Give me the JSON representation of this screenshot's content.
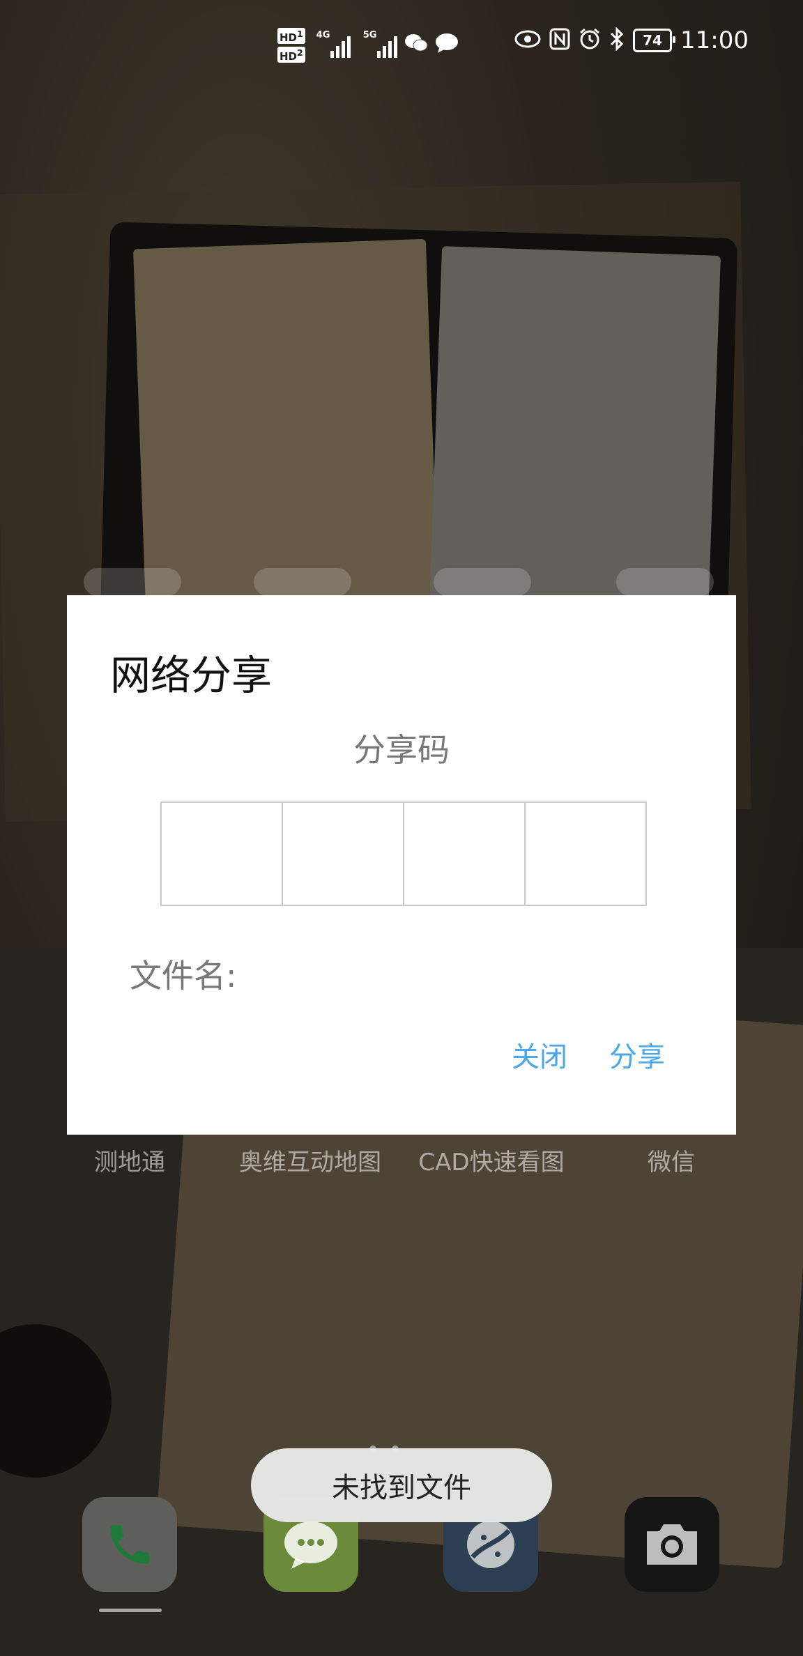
{
  "status_bar": {
    "hd1": "HD",
    "hd1_sub": "1",
    "hd2": "HD",
    "hd2_sub": "2",
    "net1": "4G",
    "net2": "5G",
    "battery": "74",
    "time": "11:00",
    "icons": [
      "hd-icon",
      "signal-icon",
      "wechat-icon",
      "message-icon",
      "eye-icon",
      "nfc-icon",
      "alarm-icon",
      "bluetooth-icon",
      "battery-icon"
    ]
  },
  "app_labels": [
    "测地通",
    "奥维互动地图",
    "CAD快速看图",
    "微信"
  ],
  "dialog": {
    "title": "网络分享",
    "subtitle": "分享码",
    "code_boxes": [
      "",
      "",
      "",
      ""
    ],
    "file_label": "文件名:",
    "close_label": "关闭",
    "share_label": "分享"
  },
  "toast": {
    "text": "未找到文件"
  },
  "dock": [
    "phone-icon",
    "messages-icon",
    "browser-icon",
    "camera-icon"
  ]
}
